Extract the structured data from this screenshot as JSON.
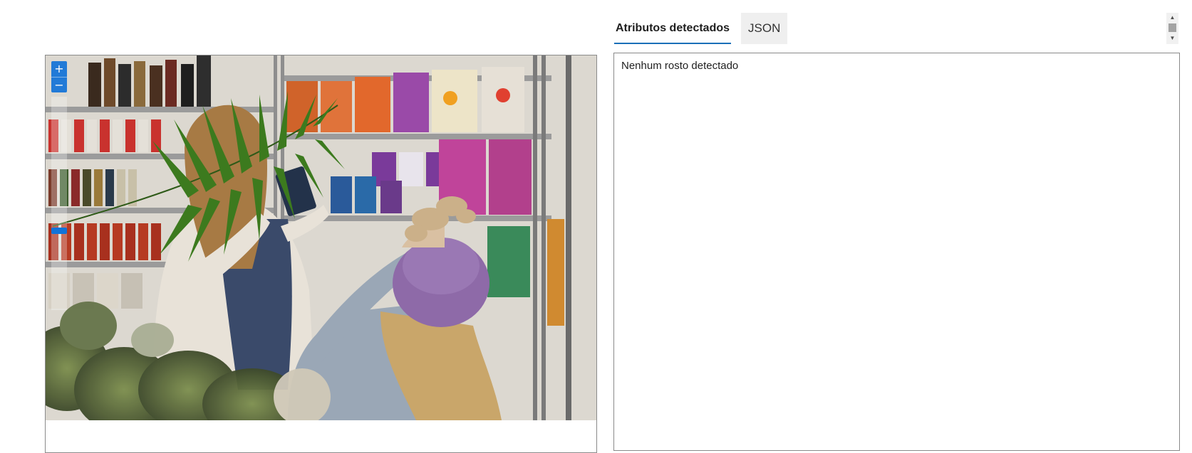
{
  "image_panel": {
    "zoom_in_label": "+",
    "zoom_out_label": "−",
    "photo_description_icon": "shop-photo"
  },
  "tabs": [
    {
      "label": "Atributos detectados",
      "active": true
    },
    {
      "label": "JSON",
      "active": false
    }
  ],
  "results": {
    "message": "Nenhum rosto detectado"
  },
  "scrollbar": {
    "up_icon": "▲",
    "down_icon": "▼"
  },
  "colors": {
    "accent": "#1a6fb8",
    "zoom_blue": "#1273d8",
    "border": "#8a8a8a"
  }
}
